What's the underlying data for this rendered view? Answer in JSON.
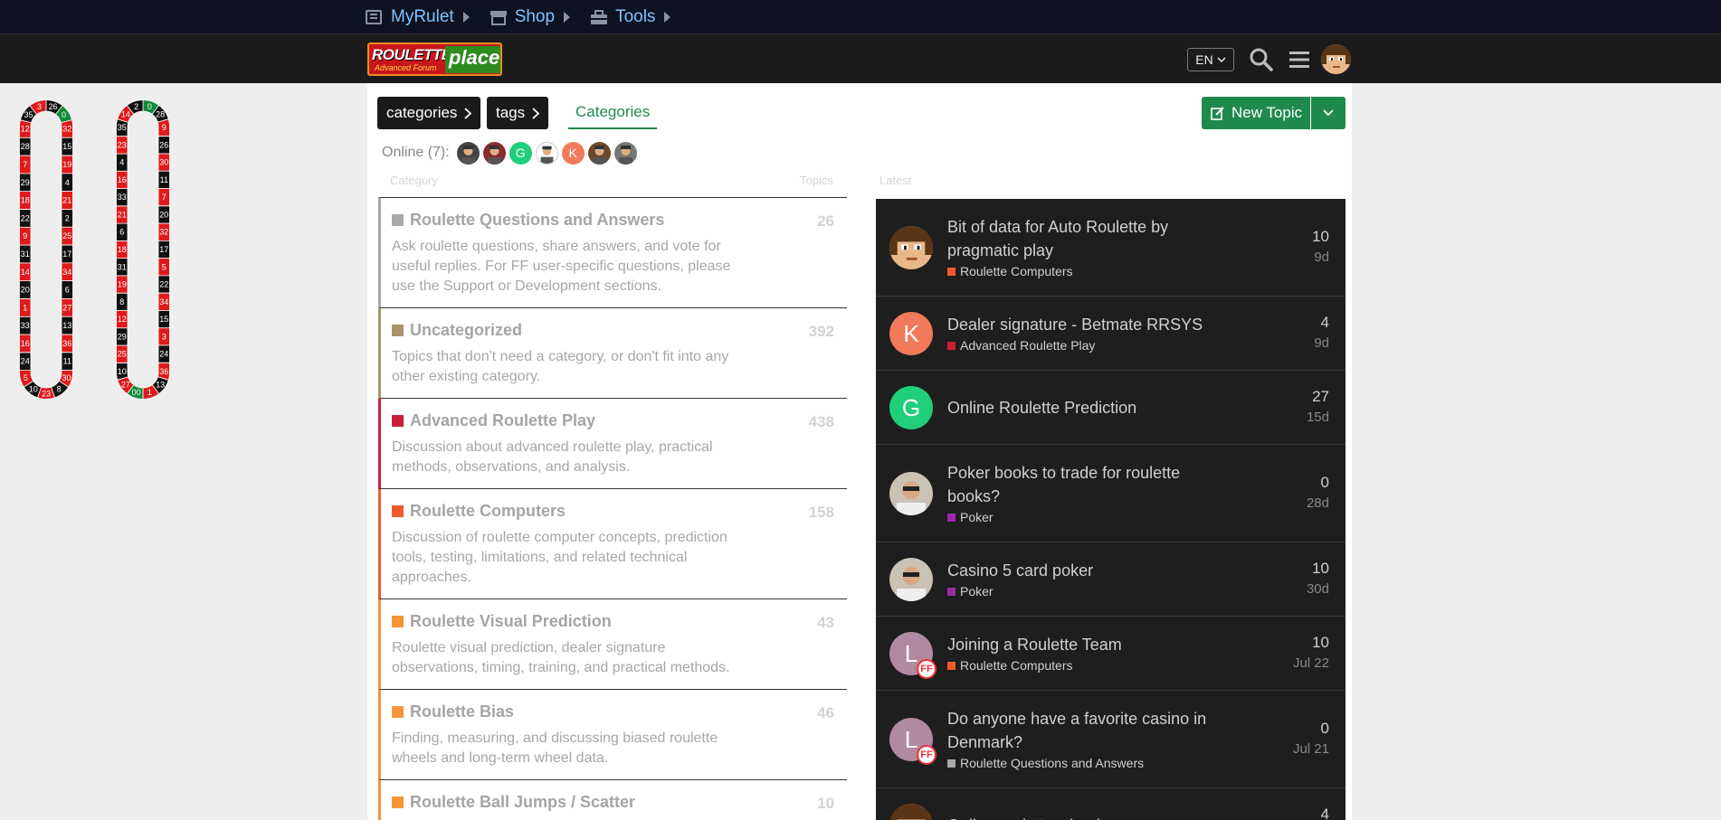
{
  "topnav": {
    "items": [
      {
        "label": "MyRulet"
      },
      {
        "label": "Shop"
      },
      {
        "label": "Tools"
      }
    ]
  },
  "header": {
    "logo": {
      "word1": "ROULETTE",
      "word2": "place",
      "tagline": "Advanced Forum"
    },
    "language": "EN"
  },
  "nav": {
    "categories_label": "categories",
    "tags_label": "tags",
    "active_tab": "Categories",
    "new_topic_label": "New Topic"
  },
  "online": {
    "label": "Online (7):",
    "users": [
      {
        "initial": "",
        "color": "#444444"
      },
      {
        "initial": "",
        "color": "#8a2a2a"
      },
      {
        "initial": "G",
        "color": "#1fcf7a"
      },
      {
        "initial": "",
        "color": "#ffffff"
      },
      {
        "initial": "K",
        "color": "#f07a5a"
      },
      {
        "initial": "",
        "color": "#6a4a2a"
      },
      {
        "initial": "",
        "color": "#777777"
      }
    ]
  },
  "columns": {
    "category": "Category",
    "topics": "Topics",
    "latest": "Latest"
  },
  "categories": [
    {
      "name": "Roulette Questions and Answers",
      "count": "26",
      "color": "#a8a8a8",
      "desc": "Ask roulette questions, share answers, and vote for useful replies. For FF user-specific questions, please use the Support or Development sections."
    },
    {
      "name": "Uncategorized",
      "count": "392",
      "color": "#a8956b",
      "desc": "Topics that don't need a category, or don't fit into any other existing category."
    },
    {
      "name": "Advanced Roulette Play",
      "count": "438",
      "color": "#c8203a",
      "desc": "Discussion about advanced roulette play, practical methods, observations, and analysis."
    },
    {
      "name": "Roulette Computers",
      "count": "158",
      "color": "#f05a2a",
      "desc": "Discussion of roulette computer concepts, prediction tools, testing, limitations, and related technical approaches."
    },
    {
      "name": "Roulette Visual Prediction",
      "count": "43",
      "color": "#f7943a",
      "desc": "Roulette visual prediction, dealer signature observations, timing, training, and practical methods."
    },
    {
      "name": "Roulette Bias",
      "count": "46",
      "color": "#f7943a",
      "desc": "Finding, measuring, and discussing biased roulette wheels and long-term wheel data."
    },
    {
      "name": "Roulette Ball Jumps / Scatter",
      "count": "10",
      "color": "#f7943a",
      "desc": ""
    }
  ],
  "topics": [
    {
      "title": "Bit of data for Auto Roulette by pragmatic play",
      "tag": "Roulette Computers",
      "tag_color": "#f05a2a",
      "replies": "10",
      "age": "9d",
      "avatar": "pixel",
      "initial": "",
      "ff": false
    },
    {
      "title": "Dealer signature - Betmate RRSYS",
      "tag": "Advanced Roulette Play",
      "tag_color": "#c8203a",
      "replies": "4",
      "age": "9d",
      "avatar": "letter",
      "initial": "K",
      "avatar_color": "#f07a5a",
      "ff": false
    },
    {
      "title": "Online Roulette Prediction",
      "tag": "",
      "tag_color": "",
      "replies": "27",
      "age": "15d",
      "avatar": "letter",
      "initial": "G",
      "avatar_color": "#1fcf7a",
      "ff": false
    },
    {
      "title": "Poker books to trade for roulette books?",
      "tag": "Poker",
      "tag_color": "#9b2aa8",
      "replies": "0",
      "age": "28d",
      "avatar": "photo",
      "initial": "",
      "ff": false
    },
    {
      "title": "Casino 5 card poker",
      "tag": "Poker",
      "tag_color": "#9b2aa8",
      "replies": "10",
      "age": "30d",
      "avatar": "photo",
      "initial": "",
      "ff": false
    },
    {
      "title": "Joining a Roulette Team",
      "tag": "Roulette Computers",
      "tag_color": "#f05a2a",
      "replies": "10",
      "age": "Jul 22",
      "avatar": "letter",
      "initial": "L",
      "avatar_color": "#b08aa0",
      "ff": true
    },
    {
      "title": "Do anyone have a favorite casino in Denmark?",
      "tag": "Roulette Questions and Answers",
      "tag_color": "#a8a8a8",
      "replies": "0",
      "age": "Jul 21",
      "avatar": "letter",
      "initial": "L",
      "avatar_color": "#b08aa0",
      "ff": true
    },
    {
      "title": "Online roulette wheels",
      "tag": "",
      "tag_color": "",
      "replies": "4",
      "age": "",
      "avatar": "pixel",
      "initial": "",
      "ff": false
    }
  ],
  "wheels": {
    "european": [
      "26",
      "0",
      "32",
      "15",
      "19",
      "4",
      "21",
      "2",
      "25",
      "17",
      "34",
      "6",
      "27",
      "13",
      "36",
      "11",
      "30",
      "8",
      "23",
      "10",
      "5",
      "24",
      "16",
      "33",
      "1",
      "20",
      "14",
      "31",
      "9",
      "22",
      "18",
      "29",
      "7",
      "28",
      "12",
      "35",
      "3"
    ],
    "american": [
      "0",
      "28",
      "9",
      "26",
      "30",
      "11",
      "7",
      "20",
      "32",
      "17",
      "5",
      "22",
      "34",
      "15",
      "3",
      "24",
      "36",
      "13",
      "1",
      "00",
      "27",
      "10",
      "25",
      "29",
      "12",
      "8",
      "19",
      "31",
      "18",
      "6",
      "21",
      "33",
      "16",
      "4",
      "23",
      "35",
      "14",
      "2"
    ]
  },
  "colors": {
    "accent": "#1f8a4c",
    "link": "#7ec3ff",
    "red": "#e01a1a",
    "black": "#111111",
    "green": "#138a3a"
  }
}
